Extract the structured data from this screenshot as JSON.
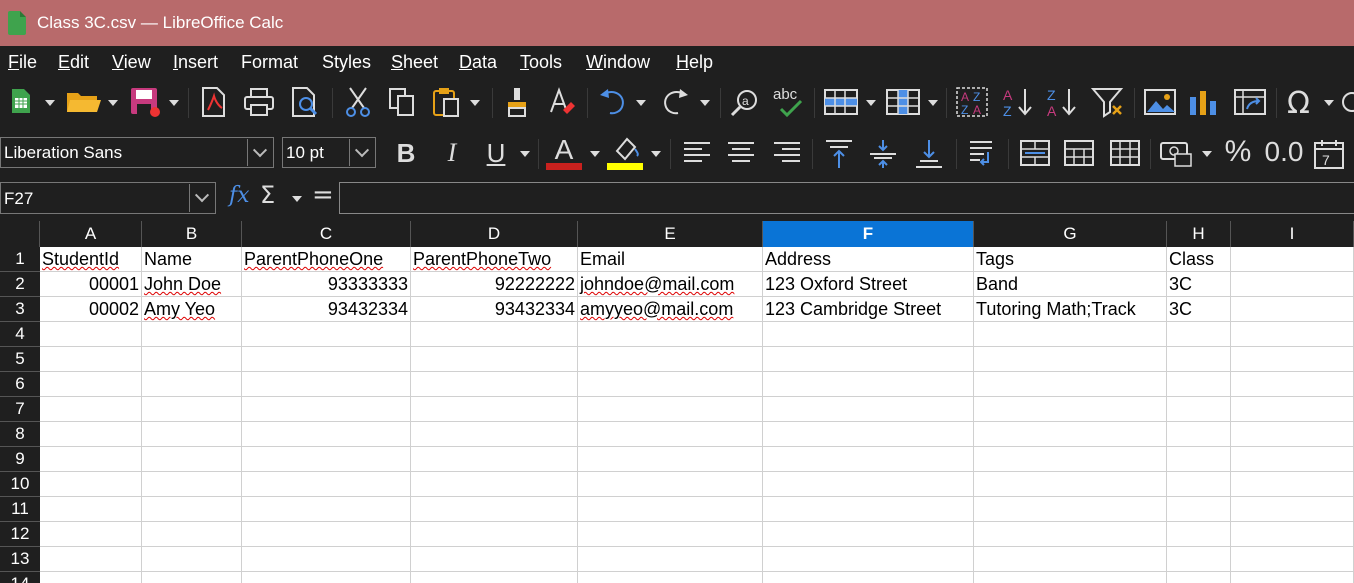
{
  "window": {
    "title": "Class 3C.csv — LibreOffice Calc"
  },
  "menu": [
    {
      "label": "File",
      "key": "F",
      "rest": "ile"
    },
    {
      "label": "Edit",
      "key": "E",
      "rest": "dit"
    },
    {
      "label": "View",
      "key": "V",
      "rest": "iew"
    },
    {
      "label": "Insert",
      "key": "I",
      "rest": "nsert"
    },
    {
      "label": "Format",
      "key": "",
      "rest": "Format"
    },
    {
      "label": "Styles",
      "key": "",
      "rest": "Styles"
    },
    {
      "label": "Sheet",
      "key": "S",
      "rest": "heet"
    },
    {
      "label": "Data",
      "key": "D",
      "rest": "ata"
    },
    {
      "label": "Tools",
      "key": "T",
      "rest": "ools"
    },
    {
      "label": "Window",
      "key": "W",
      "rest": "indow"
    },
    {
      "label": "Help",
      "key": "H",
      "rest": "elp"
    }
  ],
  "format_bar": {
    "font_name": "Liberation Sans",
    "font_size": "10 pt",
    "bold": "B",
    "italic": "I",
    "underline": "U",
    "font_color_letter": "A",
    "percent": "%",
    "decimal": "0.0"
  },
  "formula_bar": {
    "name_box": "F27",
    "fx_label": "fx",
    "sigma_label": "Σ",
    "equals_label": "=",
    "content": ""
  },
  "sheet": {
    "selected_column": "F",
    "columns": [
      "A",
      "B",
      "C",
      "D",
      "E",
      "F",
      "G",
      "H",
      "I"
    ],
    "rows": [
      "1",
      "2",
      "3",
      "4",
      "5",
      "6",
      "7",
      "8",
      "9",
      "10",
      "11",
      "12",
      "13",
      "14"
    ],
    "header_row": [
      "StudentId",
      "Name",
      "ParentPhoneOne",
      "ParentPhoneTwo",
      "Email",
      "Address",
      "Tags",
      "Class"
    ],
    "data_rows": [
      [
        "00001",
        "John Doe",
        "93333333",
        "92222222",
        "johndoe@mail.com",
        "123 Oxford Street",
        "Band",
        "3C"
      ],
      [
        "00002",
        "Amy Yeo",
        "93432334",
        "93432334",
        "amyyeo@mail.com",
        "123 Cambridge Street",
        "Tutoring Math;Track",
        "3C"
      ]
    ]
  },
  "colors": {
    "titlebar": "#b86a6b",
    "selected_header": "#0a74d6",
    "font_color": "#c9211e",
    "highlight_color": "#ffff00"
  }
}
